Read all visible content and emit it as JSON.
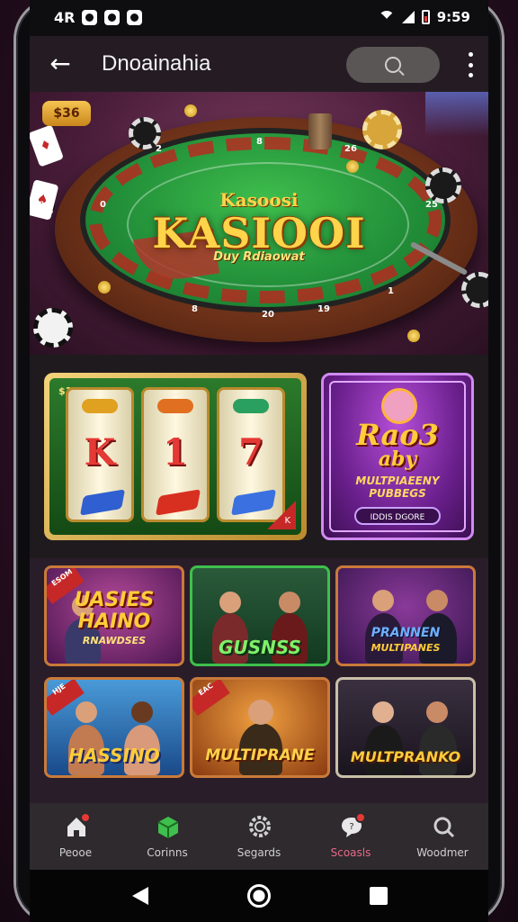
{
  "status_bar": {
    "left_text": "4R",
    "time": "9:59"
  },
  "app_bar": {
    "title": "Dnoainahia"
  },
  "hero": {
    "price_tag": "$36",
    "logo_top": "Kasoosi",
    "logo": "KASIOOI",
    "logo_sub": "Duy Rdiaowat",
    "felt_numbers": [
      "2",
      "8",
      "26",
      "0",
      "25",
      "8",
      "20",
      "19",
      "1"
    ]
  },
  "featured": {
    "slot": {
      "badge": "$100T",
      "reels": [
        "K",
        "1",
        "7"
      ],
      "corner": "K"
    },
    "multiplayer": {
      "title_line1": "Rao3",
      "title_line2": "aby",
      "subtitle_line1": "MULTPIAEENY",
      "subtitle_line2": "PUBBEGS",
      "button": "IDDIS DGORE"
    }
  },
  "games": [
    {
      "label": "UASIES HAINO",
      "sublabel": "RNAWDSES",
      "ribbon": "ESOM"
    },
    {
      "label": "GUSNSS",
      "sublabel": "",
      "ribbon": ""
    },
    {
      "label": "PRANNEN",
      "sublabel": "MULTIPANES",
      "ribbon": ""
    },
    {
      "label": "HASSINO",
      "sublabel": "",
      "ribbon": "HJE"
    },
    {
      "label": "MULTIPRANE",
      "sublabel": "",
      "ribbon": "EAC"
    },
    {
      "label": "MULTPRANKO",
      "sublabel": "",
      "ribbon": ""
    }
  ],
  "bottom_nav": [
    {
      "label": "Peooe",
      "icon": "home-icon",
      "badge": true,
      "color": "#e8e8e8"
    },
    {
      "label": "Corinns",
      "icon": "cube-icon",
      "badge": false,
      "color": "#3fbf4d"
    },
    {
      "label": "Segards",
      "icon": "gear-icon",
      "badge": false,
      "color": "#cfcfcf"
    },
    {
      "label": "Scoasls",
      "icon": "chat-icon",
      "badge": true,
      "color": "#e86a8a"
    },
    {
      "label": "Woodmer",
      "icon": "search-icon",
      "badge": false,
      "color": "#cfcfcf"
    }
  ],
  "colors": {
    "accent_gold": "#ffd34a",
    "felt_green": "#23913a",
    "badge_red": "#e53935",
    "purple": "#6a1f8c"
  }
}
